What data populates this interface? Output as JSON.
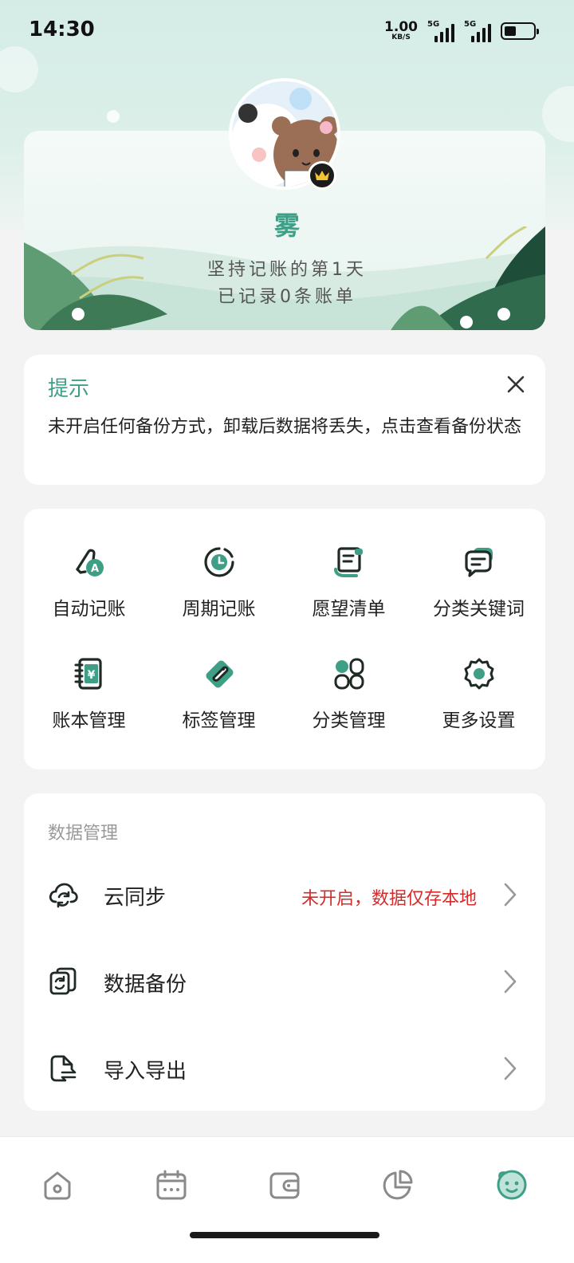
{
  "status_bar": {
    "time": "14:30",
    "net_speed_value": "1.00",
    "net_speed_unit": "KB/S",
    "signal_1_label": "5G",
    "signal_2_label": "5G",
    "battery_icon": "battery-icon"
  },
  "profile": {
    "name": "雾",
    "streak_text": "坚持记账的第1天",
    "count_text": "已记录0条账单",
    "avatar_icon": "avatar-cartoon-icon",
    "badge_icon": "crown-icon"
  },
  "tip": {
    "title": "提示",
    "text": "未开启任何备份方式，卸载后数据将丢失，点击查看备份状态",
    "close_icon": "close-icon"
  },
  "features": [
    {
      "label": "自动记账",
      "icon": "auto-bookkeeping-icon"
    },
    {
      "label": "周期记账",
      "icon": "periodic-bookkeeping-icon"
    },
    {
      "label": "愿望清单",
      "icon": "wishlist-icon"
    },
    {
      "label": "分类关键词",
      "icon": "category-keyword-icon"
    },
    {
      "label": "账本管理",
      "icon": "ledger-icon"
    },
    {
      "label": "标签管理",
      "icon": "tag-icon"
    },
    {
      "label": "分类管理",
      "icon": "category-icon"
    },
    {
      "label": "更多设置",
      "icon": "settings-gear-icon"
    }
  ],
  "data_management": {
    "header": "数据管理",
    "rows": [
      {
        "label": "云同步",
        "status": "未开启，数据仅存本地",
        "icon": "cloud-sync-icon"
      },
      {
        "label": "数据备份",
        "status": "",
        "icon": "backup-icon"
      },
      {
        "label": "导入导出",
        "status": "",
        "icon": "import-export-icon"
      }
    ]
  },
  "bottom_nav": [
    {
      "icon": "home-icon"
    },
    {
      "icon": "calendar-icon"
    },
    {
      "icon": "wallet-icon"
    },
    {
      "icon": "pie-chart-icon"
    },
    {
      "icon": "profile-face-icon",
      "active": true
    }
  ],
  "colors": {
    "accent": "#3e9f86",
    "warning": "#d62b2b",
    "icon_dark": "#1f2a24",
    "background": "#f3f3f3"
  }
}
